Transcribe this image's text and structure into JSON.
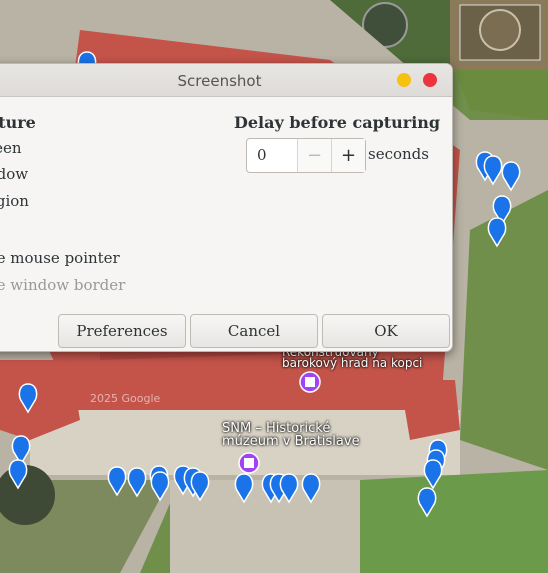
{
  "dialog": {
    "title": "Screenshot",
    "capture_heading": "pture",
    "capture_options": [
      "reen",
      "ndow",
      "egion"
    ],
    "include_pointer": "he mouse pointer",
    "include_border": "he window border",
    "delay_heading": "Delay before capturing",
    "delay_value": "0",
    "delay_minus": "−",
    "delay_plus": "+",
    "delay_unit": "seconds",
    "buttons": {
      "preferences": "Preferences",
      "cancel": "Cancel",
      "ok": "OK"
    }
  },
  "map": {
    "labels": [
      {
        "text": "Rekonštruovaný"
      },
      {
        "text": "barokový hrad na kopci"
      },
      {
        "text": "SNM – Historické"
      },
      {
        "text": "múzeum v Bratislave"
      }
    ],
    "watermark": "2025 Google",
    "colors": {
      "pin": "#1a73e8",
      "pin_poi": "#a142f4",
      "roof": "#c4544a",
      "grass": "#5e8a3a"
    }
  }
}
